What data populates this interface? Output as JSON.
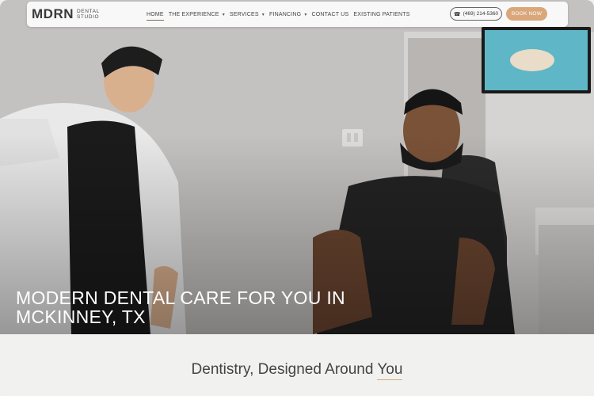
{
  "logo": {
    "mark": "MDRN",
    "subtitle": "DENTAL STUDIO"
  },
  "nav": {
    "items": [
      {
        "label": "HOME",
        "dropdown": false,
        "active": true
      },
      {
        "label": "THE EXPERIENCE",
        "dropdown": true,
        "active": false
      },
      {
        "label": "SERVICES",
        "dropdown": true,
        "active": false
      },
      {
        "label": "FINANCING",
        "dropdown": true,
        "active": false
      },
      {
        "label": "CONTACT US",
        "dropdown": false,
        "active": false
      },
      {
        "label": "EXISTING PATIENTS",
        "dropdown": false,
        "active": false
      }
    ],
    "phone": "(469) 214-5360",
    "book_label": "BOOK NOW"
  },
  "hero": {
    "title": "MODERN DENTAL CARE FOR YOU IN MCKINNEY, TX"
  },
  "section": {
    "heading_main": "Dentistry, Designed Around ",
    "heading_accent": "You"
  },
  "colors": {
    "accent": "#d9a77a",
    "nav_bg": "#ffffff",
    "page_bg": "#f1f1f0"
  },
  "icons": {
    "phone": "phone-icon",
    "chevron": "chevron-down-icon"
  }
}
